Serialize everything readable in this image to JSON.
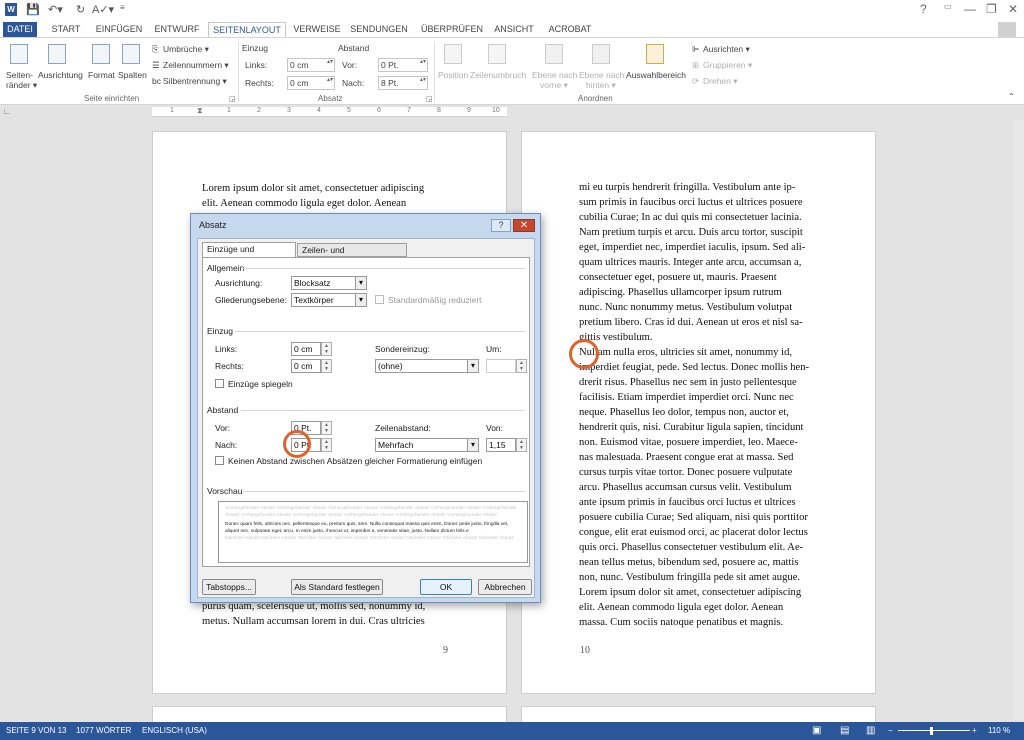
{
  "titlebar": {
    "help_btn": "?",
    "min_btn": "—",
    "restore_btn": "❐",
    "close_btn": "✕"
  },
  "tabs": [
    "DATEI",
    "START",
    "EINFÜGEN",
    "ENTWURF",
    "SEITENLAYOUT",
    "VERWEISE",
    "SENDUNGEN",
    "ÜBERPRÜFEN",
    "ANSICHT",
    "ACROBAT"
  ],
  "ribbon": {
    "seiten": {
      "raender": "Seiten-",
      "raender2": "ränder ▾",
      "ausrichtung": "Ausrichtung",
      "format": "Format",
      "spalten": "Spalten",
      "umbrueche": "Umbrüche ▾",
      "zeilennummern": "Zeilennummern ▾",
      "silbentrennung": "Silbentrennung ▾",
      "group": "Seite einrichten"
    },
    "absatz": {
      "einzug": "Einzug",
      "links_lbl": "Links:",
      "links_val": "0 cm",
      "rechts_lbl": "Rechts:",
      "rechts_val": "0 cm",
      "abstand": "Abstand",
      "vor_lbl": "Vor:",
      "vor_val": "0 Pt.",
      "nach_lbl": "Nach:",
      "nach_val": "8 Pt.",
      "group": "Absatz"
    },
    "anordnen": {
      "position": "Position",
      "zeilenumbruch": "Zeilenumbruch",
      "ebene_vorne": "Ebene nach",
      "vorne": "vorne ▾",
      "ebene_hinten": "Ebene nach",
      "hinten": "hinten ▾",
      "auswahl": "Auswahlbereich",
      "ausrichten": "Ausrichten ▾",
      "gruppieren": "Gruppieren ▾",
      "drehen": "Drehen ▾",
      "group": "Anordnen"
    }
  },
  "ruler": {
    "marks": [
      "1",
      "1",
      "2",
      "3",
      "4",
      "5",
      "6",
      "7",
      "8",
      "9",
      "10"
    ]
  },
  "page_left": {
    "top_lines": [
      "Lorem ipsum dolor sit amet, consectetuer adipiscing",
      "elit. Aenean commodo ligula eget dolor. Aenean"
    ],
    "bottom_lines": [
      "purus quam, scelerisque ut, mollis sed, nonummy id,",
      "metus. Nullam accumsan lorem in dui. Cras ultricies"
    ],
    "page_number": "9"
  },
  "page_right": {
    "lines": [
      "mi eu turpis hendrerit fringilla. Vestibulum ante ip-",
      "sum primis in faucibus orci luctus et ultrices posuere",
      "cubilia Curae; In ac dui quis mi consectetuer lacinia.",
      "Nam pretium turpis et arcu. Duis arcu tortor, suscipit",
      "eget, imperdiet nec, imperdiet iaculis, ipsum. Sed ali-",
      "quam ultrices mauris. Integer ante arcu, accumsan a,",
      "consectetuer eget, posuere ut, mauris. Praesent",
      "adipiscing. Phasellus ullamcorper ipsum rutrum",
      "nunc. Nunc nonummy metus. Vestibulum volutpat",
      "pretium libero. Cras id dui. Aenean ut eros et nisl sa-",
      "gittis vestibulum.",
      "Nullam nulla eros, ultricies sit amet, nonummy id,",
      "imperdiet feugiat, pede. Sed lectus. Donec mollis hen-",
      "drerit risus. Phasellus nec sem in justo pellentesque",
      "facilisis. Etiam imperdiet imperdiet orci. Nunc nec",
      "neque. Phasellus leo dolor, tempus non, auctor et,",
      "hendrerit quis, nisi. Curabitur ligula sapien, tincidunt",
      "non. Euismod vitae, posuere imperdiet, leo. Maece-",
      "nas malesuada. Praesent congue erat at massa. Sed",
      "cursus turpis vitae tortor. Donec posuere vulputate",
      "arcu. Phasellus accumsan cursus velit. Vestibulum",
      "ante ipsum primis in faucibus orci luctus et ultrices",
      "posuere cubilia Curae; Sed aliquam, nisi quis porttitor",
      "congue, elit erat euismod orci, ac placerat dolor lectus",
      "quis orci. Phasellus consectetuer vestibulum elit. Ae-",
      "nean tellus metus, bibendum sed, posuere ac, mattis",
      "non, nunc. Vestibulum fringilla pede sit amet augue.",
      "Lorem ipsum dolor sit amet, consectetuer adipiscing",
      "elit. Aenean commodo ligula eget dolor. Aenean",
      "massa. Cum sociis natoque penatibus et magnis."
    ],
    "page_number": "10"
  },
  "dialog": {
    "title": "Absatz",
    "help": "?",
    "close": "✕",
    "tab1": "Einzüge und Abstände",
    "tab2": "Zeilen- und Seitenumbruch",
    "allgemein": "Allgemein",
    "ausrichtung_lbl": "Ausrichtung:",
    "ausrichtung_val": "Blocksatz",
    "gliederung_lbl": "Gliederungsebene:",
    "gliederung_val": "Textkörper",
    "standard_reduziert": "Standardmäßig reduziert",
    "einzug": "Einzug",
    "links_lbl": "Links:",
    "links_val": "0 cm",
    "rechts_lbl": "Rechts:",
    "rechts_val": "0 cm",
    "sondereinzug_lbl": "Sondereinzug:",
    "sondereinzug_val": "(ohne)",
    "um_lbl": "Um:",
    "spiegeln": "Einzüge spiegeln",
    "abstand": "Abstand",
    "vor_lbl": "Vor:",
    "vor_val": "0 Pt.",
    "nach_lbl": "Nach:",
    "nach_val": "0 Pt.",
    "zeilenabstand_lbl": "Zeilenabstand:",
    "zeilenabstand_val": "Mehrfach",
    "von_lbl": "Von:",
    "von_val": "1,15",
    "kein_abstand": "Keinen Abstand zwischen Absätzen gleicher Formatierung einfügen",
    "vorschau": "Vorschau",
    "preview_prev": "Vorhergehender Absatz Vorhergehender Absatz Vorhergehender Absatz Vorhergehender Absatz Vorhergehender Absatz Vorhergehender Absatz Vorhergehender Absatz Vorhergehender Absatz Vorhergehender Absatz Vorhergehender Absatz Vorhergehender Absatz",
    "preview_cur": "Donec quam felis, ultricies nec, pellentesque eu, pretium quis, sem. Nulla consequat massa quis enim. Donec pede justo, fringilla vel, aliquet nec, vulputate eget, arcu. In enim justo, rhoncus ut, imperdiet a, venenatis vitae, justo. Nullam dictum felis e",
    "preview_next": "Nächster Absatz Nächster Absatz Nächster Absatz Nächster Absatz Nächster Absatz Nächster Absatz Nächster Absatz Nächster Absatz",
    "tabstopps": "Tabstopps...",
    "als_standard": "Als Standard festlegen",
    "ok": "OK",
    "abbrechen": "Abbrechen"
  },
  "status": {
    "seite": "SEITE 9 VON 13",
    "woerter": "1077 WÖRTER",
    "sprache": "ENGLISCH (USA)",
    "zoom": "110 %"
  },
  "colors": {
    "accent": "#2b579a",
    "highlight": "#e0612b"
  }
}
